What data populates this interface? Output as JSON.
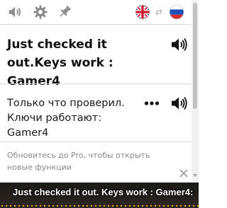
{
  "toolbar": {
    "icons": [
      "speaker-icon",
      "gear-icon",
      "pin-icon",
      "uk-flag-icon",
      "swap-icon",
      "russia-flag-icon"
    ],
    "swap_glyph": "⇄"
  },
  "translation": {
    "text": "Just checked it out.Keys work : Gamer4"
  },
  "original": {
    "text": "Только что проверил. Ключи работают: Gamer4"
  },
  "promo": {
    "text": "Обновитесь до Pro, чтобы открыть новые функции"
  },
  "subtitle": {
    "text": "Just checked it out. Keys work : Gamer4:"
  },
  "colors": {
    "icon_gray": "#8c8c8c",
    "divider": "#d9d9d9",
    "promo_text": "#8a8a8a",
    "subtitle_bg": "#1d1a17",
    "subtitle_dots": "#d49a2a"
  }
}
